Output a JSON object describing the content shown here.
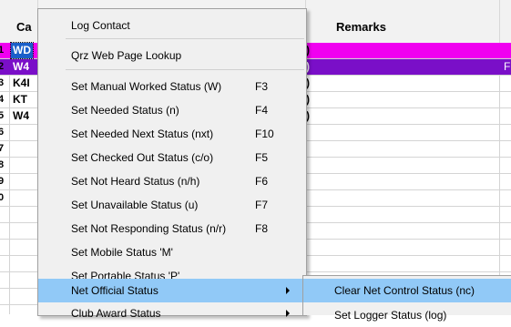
{
  "colors": {
    "selected_call_bg": "#1a5fc9",
    "row1_bg": "#f000f0",
    "row2_bg": "#7a0fc8",
    "menu_bg": "#f0f0f0",
    "menu_highlight": "#91c9f7"
  },
  "grid": {
    "headers": {
      "call": "Ca",
      "remarks": "Remarks"
    },
    "rows": [
      {
        "num": "1",
        "call": "WD",
        "frag": ")",
        "rfrag": ""
      },
      {
        "num": "2",
        "call": "W4",
        "frag": ")",
        "rfrag": "F"
      },
      {
        "num": "3",
        "call": "K4I",
        "frag": ")",
        "rfrag": ""
      },
      {
        "num": "4",
        "call": "KT",
        "frag": ")",
        "rfrag": ""
      },
      {
        "num": "5",
        "call": "W4",
        "frag": ")",
        "rfrag": ""
      },
      {
        "num": "6",
        "call": "",
        "frag": "",
        "rfrag": ""
      },
      {
        "num": "7",
        "call": "",
        "frag": "",
        "rfrag": ""
      },
      {
        "num": "8",
        "call": "",
        "frag": "",
        "rfrag": ""
      },
      {
        "num": "9",
        "call": "",
        "frag": "",
        "rfrag": ""
      },
      {
        "num": "0",
        "call": "",
        "frag": "",
        "rfrag": ""
      }
    ]
  },
  "context_menu": {
    "items": [
      {
        "label": "Log Contact",
        "shortcut": ""
      },
      {
        "label": "Qrz Web Page Lookup",
        "shortcut": ""
      },
      {
        "label": "Set Manual Worked Status (W)",
        "shortcut": "F3"
      },
      {
        "label": "Set Needed Status (n)",
        "shortcut": "F4"
      },
      {
        "label": "Set Needed Next Status (nxt)",
        "shortcut": "F10"
      },
      {
        "label": "Set Checked Out Status (c/o)",
        "shortcut": "F5"
      },
      {
        "label": "Set Not Heard Status (n/h)",
        "shortcut": "F6"
      },
      {
        "label": "Set Unavailable Status (u)",
        "shortcut": "F7"
      },
      {
        "label": "Set Not Responding Status (n/r)",
        "shortcut": "F8"
      },
      {
        "label": "Set Mobile Status 'M'",
        "shortcut": ""
      },
      {
        "label": "Set Portable Status 'P'",
        "shortcut": ""
      },
      {
        "label": "Net Official Status",
        "shortcut": ""
      },
      {
        "label": "Club Award Status",
        "shortcut": ""
      }
    ]
  },
  "submenu": {
    "items": [
      {
        "label": "Clear Net Control Status (nc)"
      },
      {
        "label": "Set Logger Status (log)"
      }
    ]
  }
}
